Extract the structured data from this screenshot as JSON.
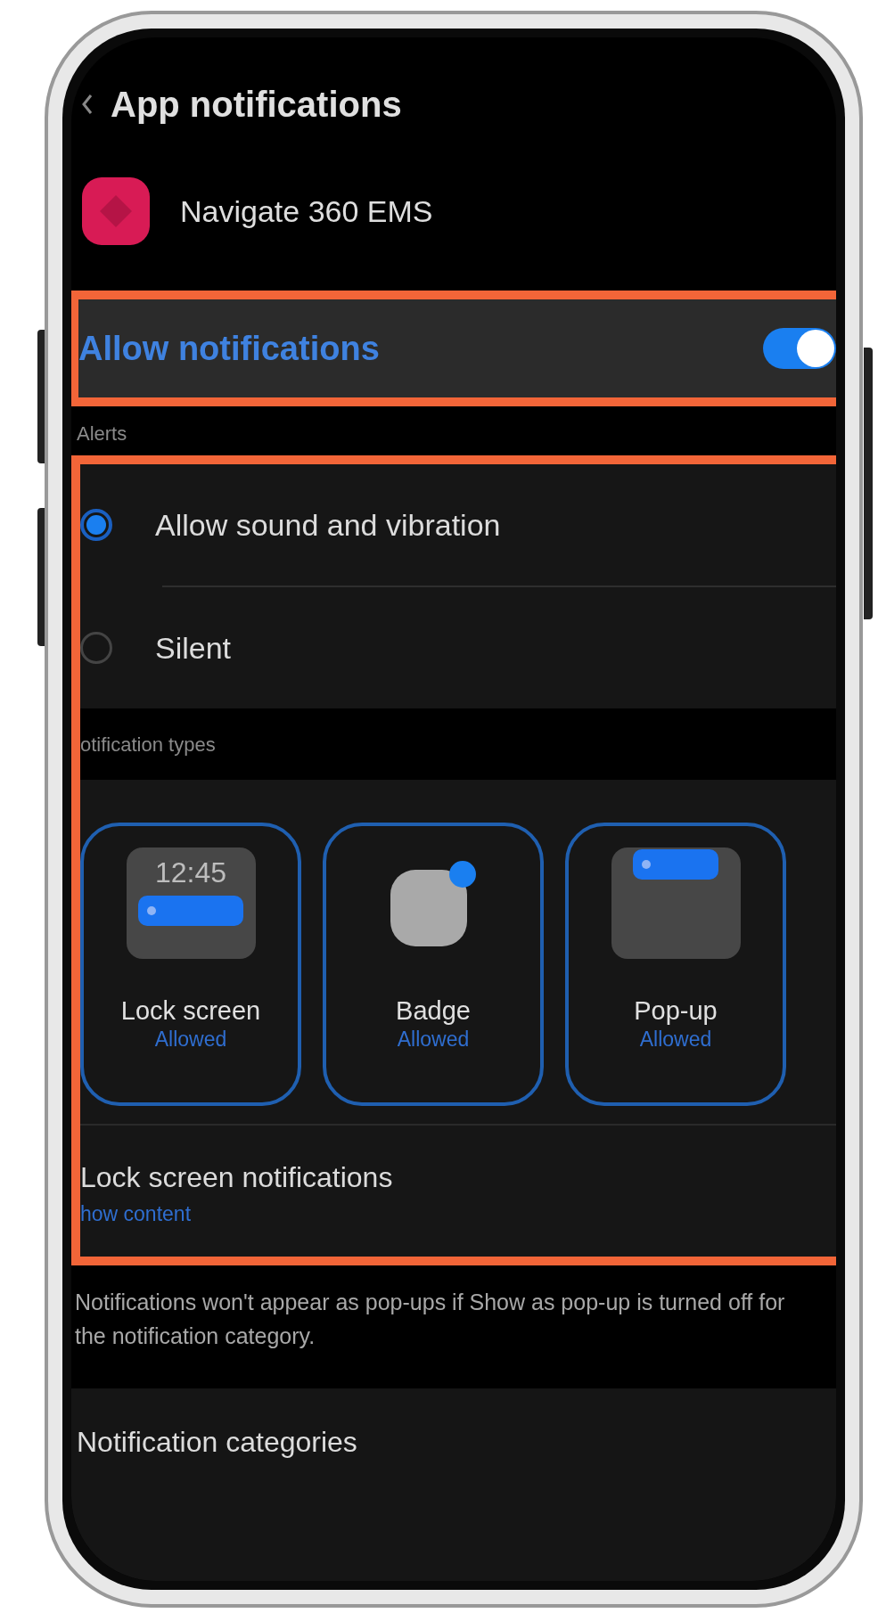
{
  "header": {
    "title": "App notifications"
  },
  "app": {
    "name": "Navigate 360 EMS"
  },
  "allow_notifications": {
    "label": "Allow notifications",
    "on": true
  },
  "alerts": {
    "heading": "Alerts",
    "options": [
      {
        "label": "Allow sound and vibration",
        "selected": true
      },
      {
        "label": "Silent",
        "selected": false
      }
    ]
  },
  "notification_types": {
    "heading": "otification types",
    "types": [
      {
        "kind": "lock_screen",
        "label": "Lock screen",
        "status": "Allowed",
        "time": "12:45",
        "selected": true
      },
      {
        "kind": "badge",
        "label": "Badge",
        "status": "Allowed",
        "selected": true
      },
      {
        "kind": "popup",
        "label": "Pop-up",
        "status": "Allowed",
        "selected": true
      }
    ]
  },
  "lock_screen_notifications": {
    "label": "Lock screen notifications",
    "value": "how content"
  },
  "note": "Notifications won't appear as pop-ups if Show as pop-up is turned off for the notification category.",
  "categories": {
    "label": "Notification categories"
  }
}
